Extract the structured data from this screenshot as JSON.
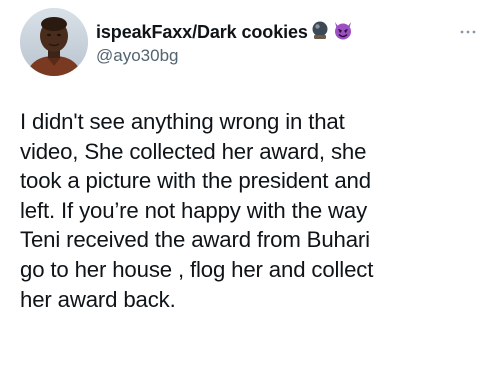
{
  "tweet": {
    "display_name": "ispeakFaxx/Dark cookies",
    "handle": "@ayo30bg",
    "name_emojis": [
      "crystal-ball-emoji",
      "smiling-face-with-horns-emoji"
    ],
    "more_icon": "more-horizontal-icon",
    "text": "I didn't see anything wrong in that\nvideo, She collected her award, she\ntook a picture with the president and\nleft. If you’re not happy with the way\nTeni received the award from Buhari\ngo to her house , flog her and collect\nher award back."
  },
  "colors": {
    "text_primary": "#0f1419",
    "text_secondary": "#536471",
    "background": "#ffffff",
    "devil_emoji": "#9b4fc0"
  }
}
